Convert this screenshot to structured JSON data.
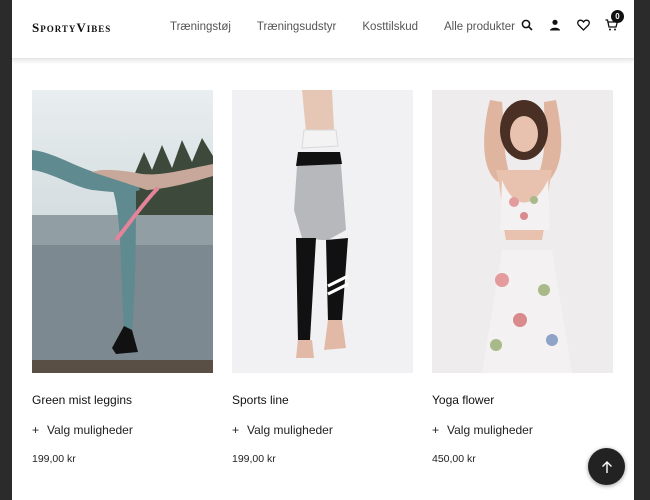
{
  "header": {
    "logo": "SportyVibes",
    "nav": [
      "Træningstøj",
      "Træningsudstyr",
      "Kosttilskud",
      "Alle produkter"
    ],
    "icons": [
      "search-icon",
      "user-icon",
      "heart-icon",
      "cart-icon"
    ],
    "cart_count": "0"
  },
  "products": [
    {
      "title": "Green mist leggins",
      "options": "Valg muligheder",
      "price": "199,00 kr"
    },
    {
      "title": "Sports line",
      "options": "Valg muligheder",
      "price": "199,00 kr"
    },
    {
      "title": "Yoga flower",
      "options": "Valg muligheder",
      "price": "450,00 kr"
    }
  ],
  "colors": {
    "background": "#2b2b2b",
    "page": "#ffffff",
    "text": "#111111",
    "to_top_button": "#222222"
  }
}
